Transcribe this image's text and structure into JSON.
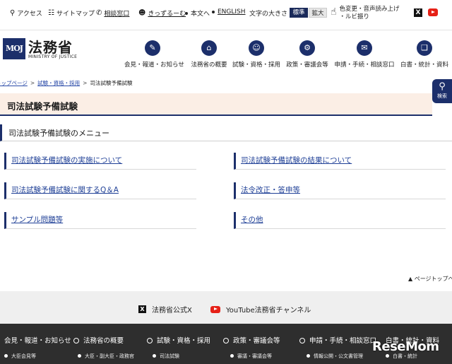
{
  "utility": {
    "access": "アクセス",
    "sitemap": "サイトマップ",
    "consult": "相談窓口",
    "kidzuru": "きっずるーむ",
    "honbun": "本文へ",
    "english": "ENGLISH",
    "font_size_label": "文字の大きさ",
    "font_standard": "標準",
    "font_large": "拡大",
    "voice_line1": "色変更・音声読み上げ",
    "voice_line2": "・ルビ振り",
    "x_icon": "X"
  },
  "header": {
    "logo_mark": "MOJ",
    "logo_name": "法務省",
    "logo_sub": "MINISTRY OF JUSTICE",
    "nav": [
      {
        "label": "会見・報道・お知らせ",
        "icon": "mic-icon",
        "glyph": "✎"
      },
      {
        "label": "法務省の概要",
        "icon": "building-icon",
        "glyph": "⌂"
      },
      {
        "label": "試験・資格・採用",
        "icon": "people-icon",
        "glyph": "☺"
      },
      {
        "label": "政策・審議会等",
        "icon": "gear-icon",
        "glyph": "⚙"
      },
      {
        "label": "申請・手続・相談窓口",
        "icon": "form-icon",
        "glyph": "✉"
      },
      {
        "label": "白書・統計・資料",
        "icon": "book-icon",
        "glyph": "❑"
      }
    ]
  },
  "breadcrumb": {
    "top": "トップページ",
    "parent": "試験・資格・採用",
    "current": "司法試験予備試験"
  },
  "search": {
    "label": "検索"
  },
  "page": {
    "title": "司法試験予備試験",
    "menu_heading": "司法試験予備試験のメニュー"
  },
  "menu_links": [
    "司法試験予備試験の実施について",
    "司法試験予備試験の結果について",
    "司法試験予備試験に関するQ＆A",
    "法令改正・答申等",
    "サンプル問題等",
    "その他"
  ],
  "pagetop": "ページトップへ",
  "footer": {
    "x_label": "法務省公式X",
    "yt_label": "YouTube法務省チャンネル",
    "cols": [
      "会見・報道・お知らせ",
      "法務省の概要",
      "試験・資格・採用",
      "政策・審議会等",
      "申請・手続・相談窓口",
      "白書・統計・資料"
    ],
    "subs": [
      "大臣会見等",
      "大臣・副大臣・政務官",
      "司法試験",
      "審議・審議会等",
      "情報公開・公文書管理",
      "白書・統計"
    ]
  },
  "watermark": "ReseMom"
}
